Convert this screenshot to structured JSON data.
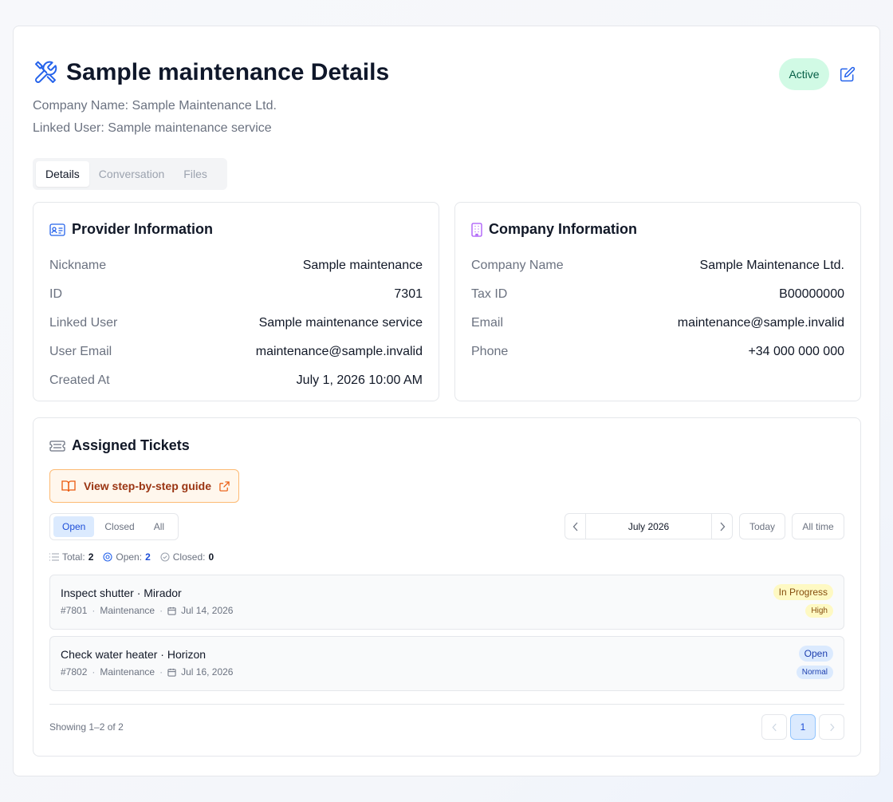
{
  "header": {
    "title": "Sample maintenance Details",
    "company_line": "Company Name: Sample Maintenance Ltd.",
    "linked_user_line": "Linked User: Sample maintenance service",
    "status": "Active",
    "header_icon": "wrench-screwdriver-icon",
    "edit_icon": "edit-icon"
  },
  "tabs": [
    "Details",
    "Conversation",
    "Files"
  ],
  "active_tab": "Details",
  "provider": {
    "title": "Provider Information",
    "icon": "id-card-icon",
    "rows": [
      {
        "label": "Nickname",
        "value": "Sample maintenance"
      },
      {
        "label": "ID",
        "value": "7301"
      },
      {
        "label": "Linked User",
        "value": "Sample maintenance service"
      },
      {
        "label": "User Email",
        "value": "maintenance@sample.invalid"
      },
      {
        "label": "Created At",
        "value": "July 1, 2026 10:00 AM"
      }
    ]
  },
  "company": {
    "title": "Company Information",
    "icon": "building-icon",
    "rows": [
      {
        "label": "Company Name",
        "value": "Sample Maintenance Ltd."
      },
      {
        "label": "Tax ID",
        "value": "B00000000"
      },
      {
        "label": "Email",
        "value": "maintenance@sample.invalid"
      },
      {
        "label": "Phone",
        "value": "+34 000 000 000"
      }
    ]
  },
  "tickets": {
    "title": "Assigned Tickets",
    "icon": "ticket-icon",
    "guide_label": "View step-by-step guide",
    "filters": [
      "Open",
      "Closed",
      "All"
    ],
    "active_filter": "Open",
    "month": "July 2026",
    "today_label": "Today",
    "all_time_label": "All time",
    "stats": {
      "total_label": "Total:",
      "total": "2",
      "open_label": "Open:",
      "open": "2",
      "closed_label": "Closed:",
      "closed": "0"
    },
    "items": [
      {
        "title": "Inspect shutter · Mirador",
        "id": "#7801",
        "category": "Maintenance",
        "date": "Jul 14, 2026",
        "status": "In Progress",
        "priority": "High"
      },
      {
        "title": "Check water heater · Horizon",
        "id": "#7802",
        "category": "Maintenance",
        "date": "Jul 16, 2026",
        "status": "Open",
        "priority": "Normal"
      }
    ],
    "showing": "Showing 1–2 of 2",
    "page": "1"
  },
  "colors": {
    "accent": "#2563eb",
    "active_badge_bg": "#d1fae5",
    "guide_bg": "#fff7ed",
    "in_progress_bg": "#fef9c3",
    "open_bg": "#dbeafe"
  }
}
